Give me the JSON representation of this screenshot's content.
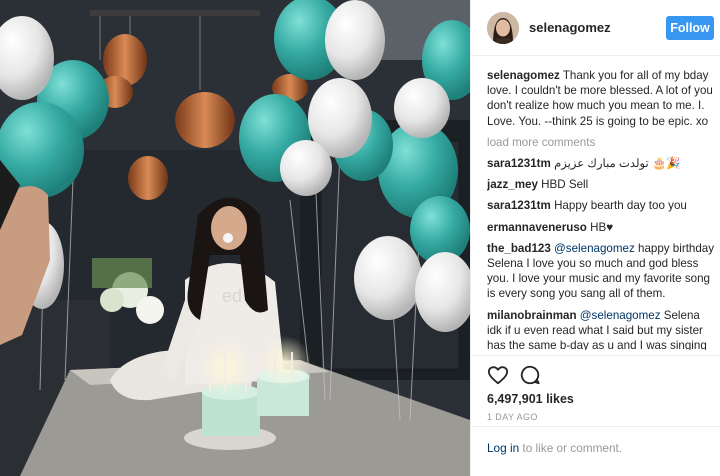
{
  "post": {
    "username": "selenagomez",
    "follow_label": "Follow",
    "caption_user": "selenagomez",
    "caption_text": "Thank you for all of my bday love. I couldn't be more blessed. A lot of you don't realize how much you mean to me. I. Love. You. --think 25 is going to be epic. xo",
    "load_more": "load more comments",
    "comments": [
      {
        "user": "sara1231tm",
        "mention": "",
        "text": "تولدت مبارك عزيزم 🎂🎉"
      },
      {
        "user": "jazz_mey",
        "mention": "",
        "text": "HBD Sell"
      },
      {
        "user": "sara1231tm",
        "mention": "",
        "text": "Happy bearth day too you"
      },
      {
        "user": "ermannaveneruso",
        "mention": "",
        "text": "HB♥"
      },
      {
        "user": "the_bad123",
        "mention": "@selenagomez",
        "text": "happy birthday Selena I love you so much and god bless you. I love your music and my favorite song is every song you sang all of them."
      },
      {
        "user": "milanobrainman",
        "mention": "@selenagomez",
        "text": "Selena idk if u even read what I said but my sister has the same b-day as u and I was singing happy bday to u but I just hope it was great"
      }
    ],
    "likes": "6,497,901 likes",
    "timestamp": "1 DAY AGO",
    "login_link": "Log in",
    "login_rest": " to like or comment.",
    "icons": {
      "like": "heart-icon",
      "comment": "comment-icon"
    }
  },
  "photo": {
    "sweater_text": "ed",
    "balloon_colors": [
      "#3fb5ad",
      "#f2f2f2"
    ]
  }
}
